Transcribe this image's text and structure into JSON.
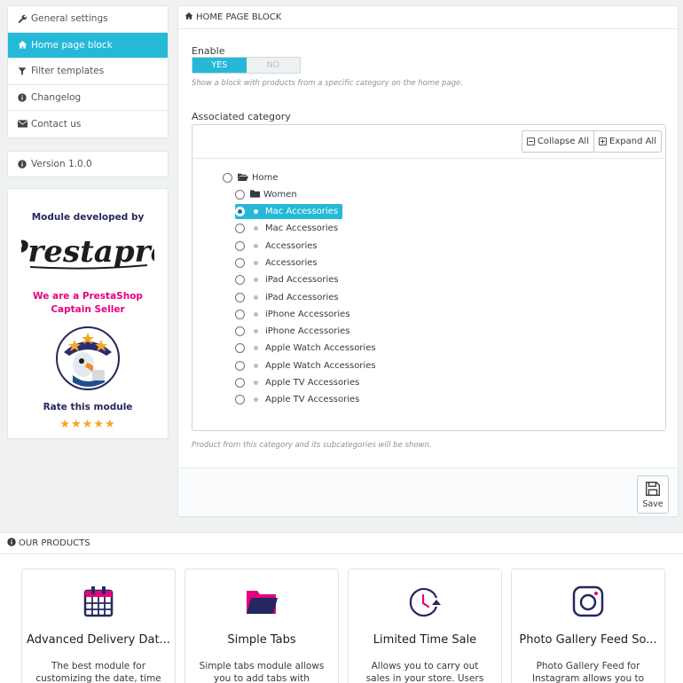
{
  "sidebar": {
    "items": [
      {
        "label": "General settings",
        "icon": "wrench-icon",
        "active": false
      },
      {
        "label": "Home page block",
        "icon": "home-icon",
        "active": true
      },
      {
        "label": "Filter templates",
        "icon": "filter-icon",
        "active": false
      },
      {
        "label": "Changelog",
        "icon": "info-icon",
        "active": false
      },
      {
        "label": "Contact us",
        "icon": "envelope-icon",
        "active": false
      }
    ],
    "version": "Version 1.0.0",
    "promo": {
      "developed_by": "Module developed by",
      "logo_text": "Prestapro",
      "captain": "We are a PrestaShop Captain Seller",
      "rate": "Rate this module",
      "stars": "★★★★★"
    }
  },
  "panel": {
    "title": "HOME PAGE BLOCK",
    "enable_label": "Enable",
    "switch_yes": "YES",
    "switch_no": "NO",
    "enable_help": "Show a block with products from a specific category on the home page.",
    "category_label": "Associated category",
    "collapse_all": "Collapse All",
    "expand_all": "Expand All",
    "category_help": "Product from this category and its subcategories will be shown.",
    "save": "Save",
    "accent": "#25b9d7"
  },
  "tree": {
    "root": "Home",
    "folder": "Women",
    "items": [
      {
        "label": "Mac Accessories",
        "selected": true
      },
      {
        "label": "Mac Accessories",
        "selected": false
      },
      {
        "label": "Accessories",
        "selected": false
      },
      {
        "label": "Accessories",
        "selected": false
      },
      {
        "label": "iPad Accessories",
        "selected": false
      },
      {
        "label": "iPad Accessories",
        "selected": false
      },
      {
        "label": "iPhone Accessories",
        "selected": false
      },
      {
        "label": "iPhone Accessories",
        "selected": false
      },
      {
        "label": "Apple Watch Accessories",
        "selected": false
      },
      {
        "label": "Apple Watch Accessories",
        "selected": false
      },
      {
        "label": "Apple TV Accessories",
        "selected": false
      },
      {
        "label": "Apple TV Accessories",
        "selected": false
      }
    ]
  },
  "products": {
    "title": "OUR PRODUCTS",
    "cards": [
      {
        "title": "Advanced Delivery Dat...",
        "desc": "The best module for customizing the date, time",
        "icon": "calendar-icon"
      },
      {
        "title": "Simple Tabs",
        "desc": "Simple tabs module allows you to add tabs with content",
        "icon": "folder-icon"
      },
      {
        "title": "Limited Time Sale",
        "desc": "Allows you to carry out sales in your store. Users see the",
        "icon": "clock-icon"
      },
      {
        "title": "Photo Gallery Feed So...",
        "desc": "Photo Gallery Feed for Instagram allows you to",
        "icon": "instagram-icon"
      }
    ]
  }
}
